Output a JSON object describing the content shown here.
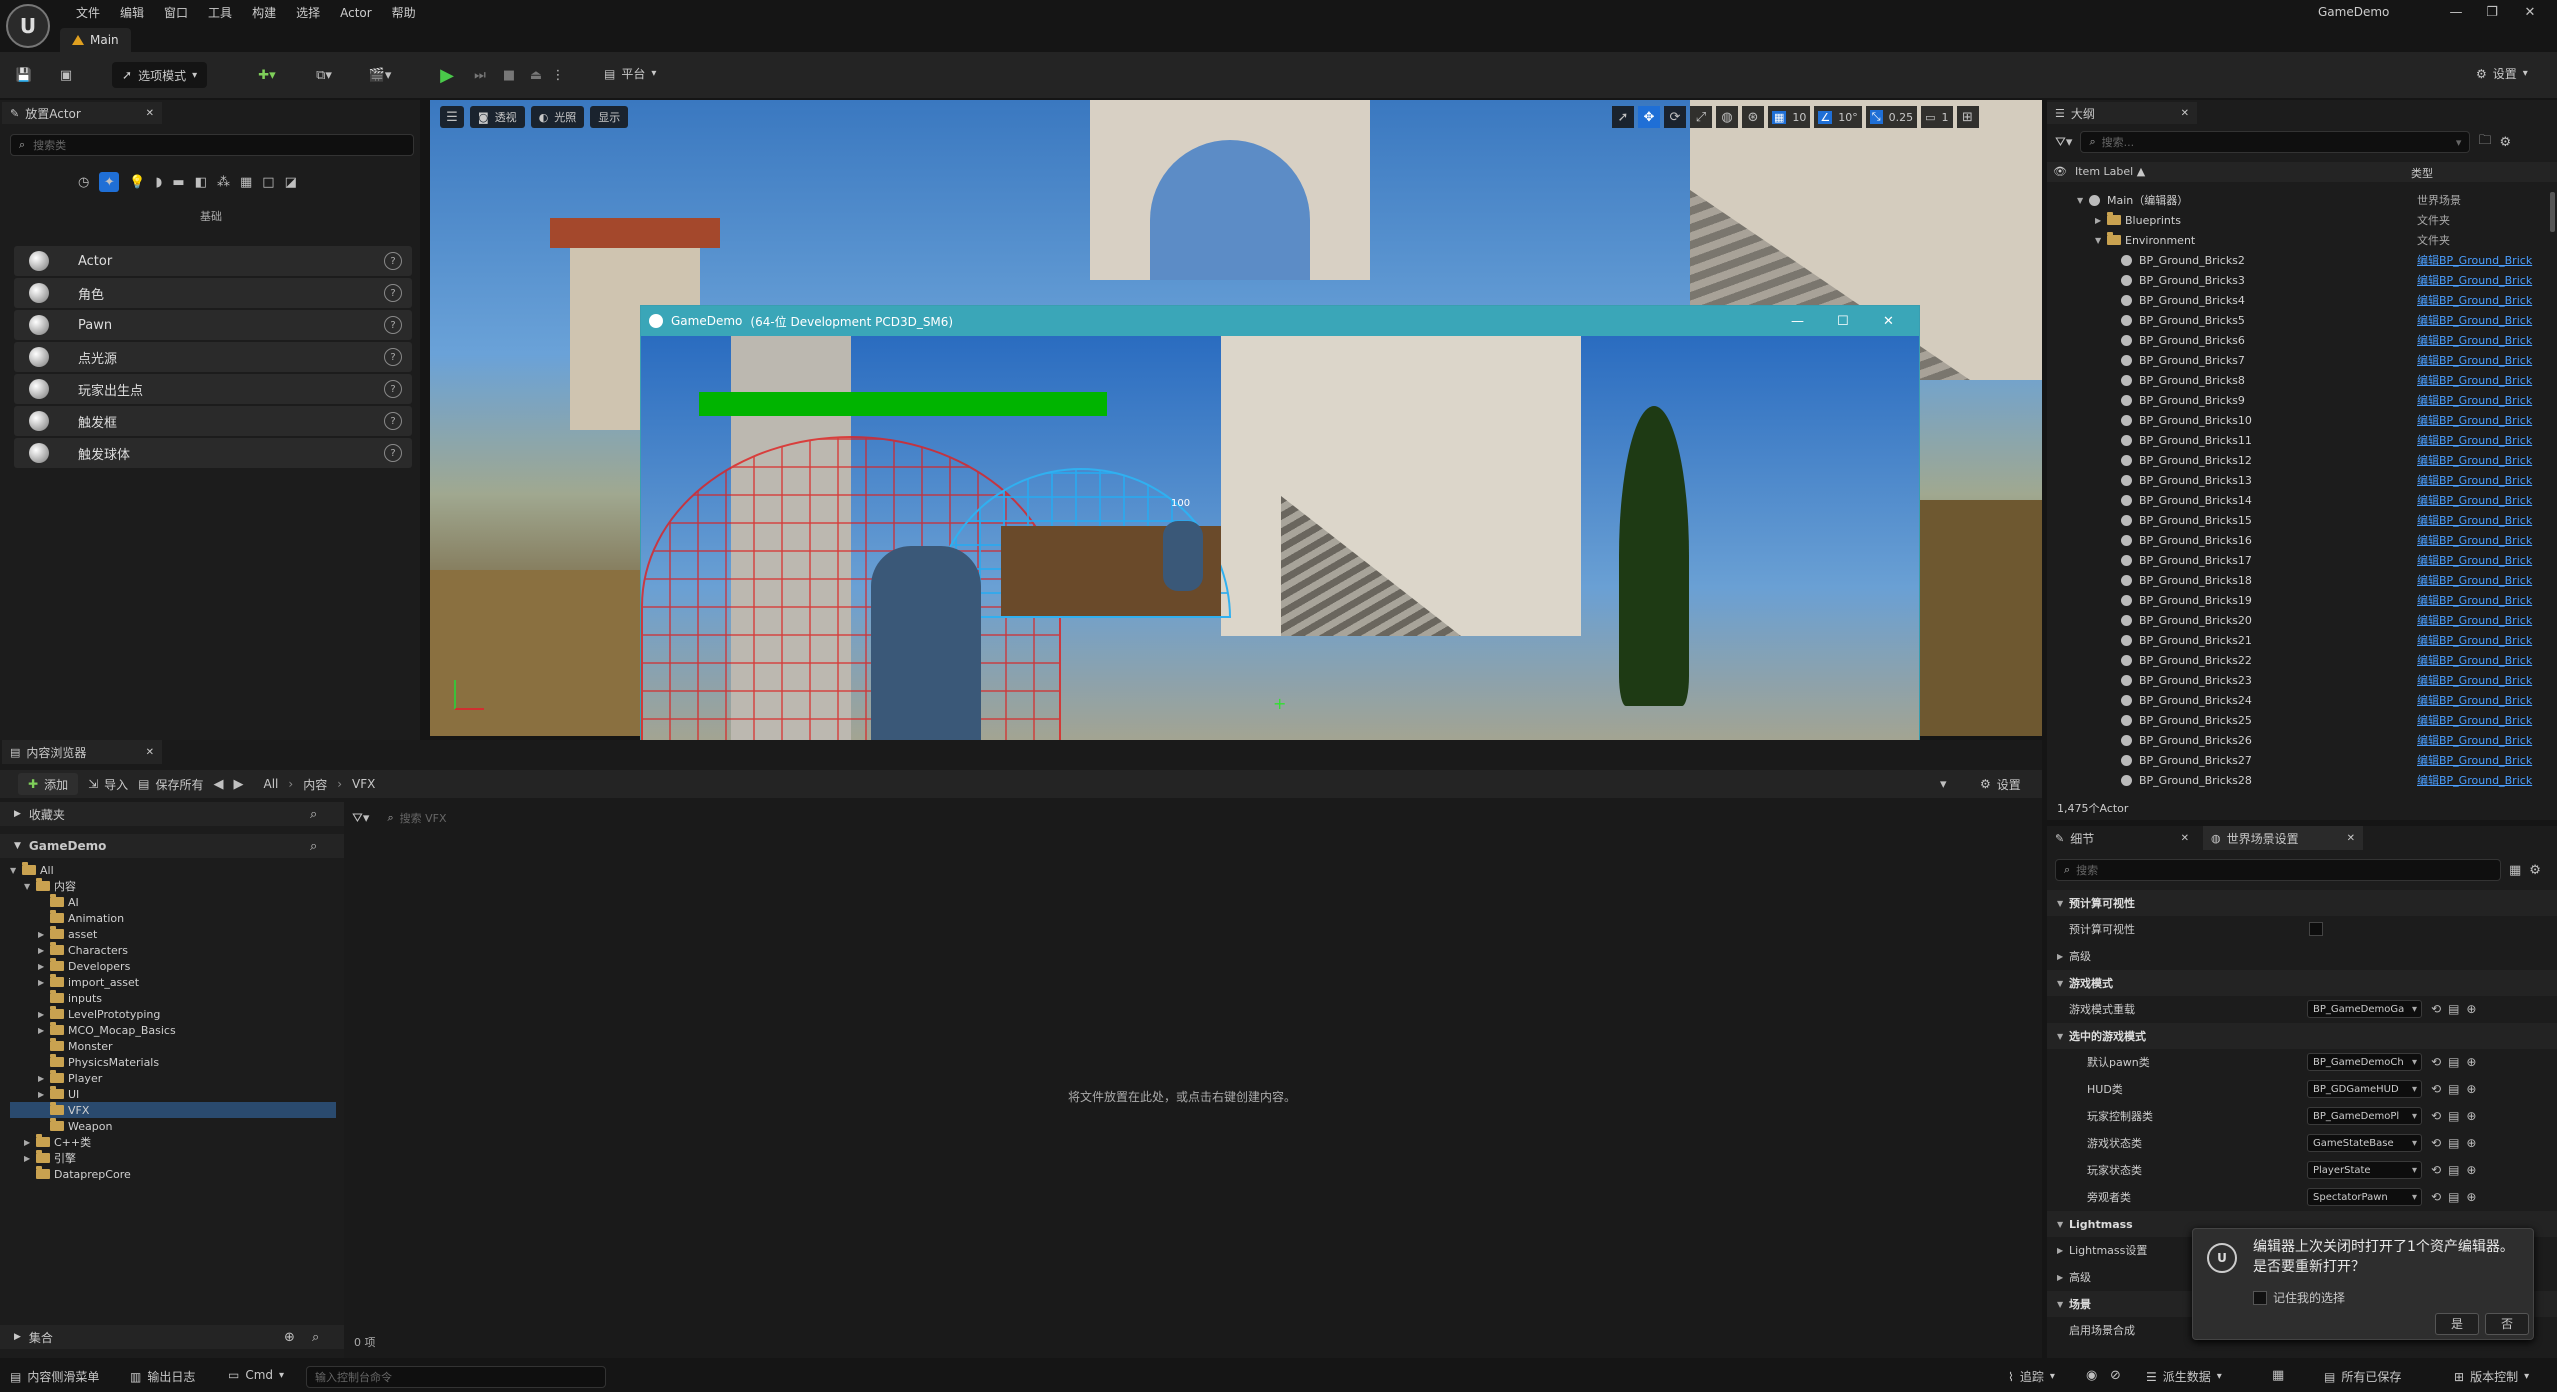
{
  "titlebar": {
    "menus": [
      "文件",
      "编辑",
      "窗口",
      "工具",
      "构建",
      "选择",
      "Actor",
      "帮助"
    ],
    "project_name": "GameDemo",
    "level_tab": "Main"
  },
  "toolbar": {
    "mode_label": "选项模式",
    "platform_label": "平台",
    "settings_label": "设置"
  },
  "place_actors": {
    "tab_title": "放置Actor",
    "search_placeholder": "搜索类",
    "category_label": "基础",
    "items": [
      {
        "label": "Actor",
        "icon": "sphere-icon"
      },
      {
        "label": "角色",
        "icon": "character-icon"
      },
      {
        "label": "Pawn",
        "icon": "pawn-icon"
      },
      {
        "label": "点光源",
        "icon": "point-light-icon"
      },
      {
        "label": "玩家出生点",
        "icon": "player-start-icon"
      },
      {
        "label": "触发框",
        "icon": "trigger-box-icon"
      },
      {
        "label": "触发球体",
        "icon": "trigger-sphere-icon"
      }
    ]
  },
  "viewport": {
    "perspective_label": "透视",
    "lit_label": "光照",
    "show_label": "显示",
    "grid_snap": "10",
    "rot_snap": "10°",
    "scale_snap": "0.25",
    "camera_speed": "1"
  },
  "game_window": {
    "title": "GameDemo",
    "subtitle": "(64-位 Development PCD3D_SM6)",
    "health_bar_fraction": 1.0,
    "hud_number": "100"
  },
  "content_browser": {
    "tab_title": "内容浏览器",
    "add_label": "添加",
    "import_label": "导入",
    "save_all_label": "保存所有",
    "breadcrumb": [
      "All",
      "内容",
      "VFX"
    ],
    "settings_label": "设置",
    "favorites_label": "收藏夹",
    "project_label": "GameDemo",
    "search_placeholder": "搜索 VFX",
    "tree": [
      {
        "label": "All",
        "depth": 0,
        "open": true
      },
      {
        "label": "内容",
        "depth": 1,
        "open": true
      },
      {
        "label": "AI",
        "depth": 2
      },
      {
        "label": "Animation",
        "depth": 2
      },
      {
        "label": "asset",
        "depth": 2,
        "arrow": true
      },
      {
        "label": "Characters",
        "depth": 2,
        "arrow": true
      },
      {
        "label": "Developers",
        "depth": 2,
        "arrow": true
      },
      {
        "label": "import_asset",
        "depth": 2,
        "arrow": true
      },
      {
        "label": "inputs",
        "depth": 2
      },
      {
        "label": "LevelPrototyping",
        "depth": 2,
        "arrow": true
      },
      {
        "label": "MCO_Mocap_Basics",
        "depth": 2,
        "arrow": true
      },
      {
        "label": "Monster",
        "depth": 2
      },
      {
        "label": "PhysicsMaterials",
        "depth": 2
      },
      {
        "label": "Player",
        "depth": 2,
        "arrow": true
      },
      {
        "label": "UI",
        "depth": 2,
        "arrow": true
      },
      {
        "label": "VFX",
        "depth": 2,
        "selected": true
      },
      {
        "label": "Weapon",
        "depth": 2
      },
      {
        "label": "C++类",
        "depth": 1,
        "arrow": true
      },
      {
        "label": "引擎",
        "depth": 1,
        "arrow": true
      },
      {
        "label": "DataprepCore",
        "depth": 1
      }
    ],
    "empty_hint": "将文件放置在此处，或点击右键创建内容。",
    "collections_label": "集合",
    "item_count": "0 项"
  },
  "outliner": {
    "tab_title": "大纲",
    "search_placeholder": "搜索...",
    "col_label": "Item Label ▲",
    "col_type": "类型",
    "root": {
      "label": "Main（编辑器）",
      "type": "世界场景"
    },
    "folders": [
      {
        "label": "Blueprints",
        "type": "文件夹"
      },
      {
        "label": "Environment",
        "type": "文件夹"
      }
    ],
    "actors": [
      "BP_Ground_Bricks2",
      "BP_Ground_Bricks3",
      "BP_Ground_Bricks4",
      "BP_Ground_Bricks5",
      "BP_Ground_Bricks6",
      "BP_Ground_Bricks7",
      "BP_Ground_Bricks8",
      "BP_Ground_Bricks9",
      "BP_Ground_Bricks10",
      "BP_Ground_Bricks11",
      "BP_Ground_Bricks12",
      "BP_Ground_Bricks13",
      "BP_Ground_Bricks14",
      "BP_Ground_Bricks15",
      "BP_Ground_Bricks16",
      "BP_Ground_Bricks17",
      "BP_Ground_Bricks18",
      "BP_Ground_Bricks19",
      "BP_Ground_Bricks20",
      "BP_Ground_Bricks21",
      "BP_Ground_Bricks22",
      "BP_Ground_Bricks23",
      "BP_Ground_Bricks24",
      "BP_Ground_Bricks25",
      "BP_Ground_Bricks26",
      "BP_Ground_Bricks27",
      "BP_Ground_Bricks28"
    ],
    "actor_type": "编辑BP_Ground_Brick",
    "count": "1,475个Actor"
  },
  "details": {
    "tab_details": "细节",
    "tab_world": "世界场景设置",
    "search_placeholder": "搜索",
    "rows": [
      {
        "kind": "section",
        "label": "预计算可视性"
      },
      {
        "kind": "prop",
        "label": "预计算可视性",
        "checkbox": true
      },
      {
        "kind": "collapsed",
        "label": "高级"
      },
      {
        "kind": "section",
        "label": "游戏模式"
      },
      {
        "kind": "prop",
        "label": "游戏模式重载",
        "value": "BP_GameDemoGa"
      },
      {
        "kind": "section",
        "label": "选中的游戏模式"
      },
      {
        "kind": "subprop",
        "label": "默认pawn类",
        "value": "BP_GameDemoCh"
      },
      {
        "kind": "subprop",
        "label": "HUD类",
        "value": "BP_GDGameHUD"
      },
      {
        "kind": "subprop",
        "label": "玩家控制器类",
        "value": "BP_GameDemoPl"
      },
      {
        "kind": "subprop",
        "label": "游戏状态类",
        "value": "GameStateBase"
      },
      {
        "kind": "subprop",
        "label": "玩家状态类",
        "value": "PlayerState"
      },
      {
        "kind": "subprop",
        "label": "旁观者类",
        "value": "SpectatorPawn"
      },
      {
        "kind": "section",
        "label": "Lightmass"
      },
      {
        "kind": "collapsed",
        "label": "Lightmass设置"
      },
      {
        "kind": "collapsed",
        "label": "高级"
      },
      {
        "kind": "section",
        "label": "场景"
      },
      {
        "kind": "prop",
        "label": "启用场景合成"
      }
    ]
  },
  "notification": {
    "message": "编辑器上次关闭时打开了1个资产编辑器。是否要重新打开？",
    "remember_label": "记住我的选择",
    "yes_label": "是",
    "no_label": "否"
  },
  "statusbar": {
    "drawer_label": "内容侧滑菜单",
    "output_log_label": "输出日志",
    "cmd_label": "Cmd",
    "console_placeholder": "输入控制台命令",
    "trace_label": "追踪",
    "derived_data_label": "派生数据",
    "all_saved_label": "所有已保存",
    "source_control_label": "版本控制"
  },
  "colors": {
    "accent_blue": "#1f6fd6",
    "health_green": "#00b400",
    "link_blue": "#4a9eff",
    "selected_row": "#2a4a6e"
  }
}
